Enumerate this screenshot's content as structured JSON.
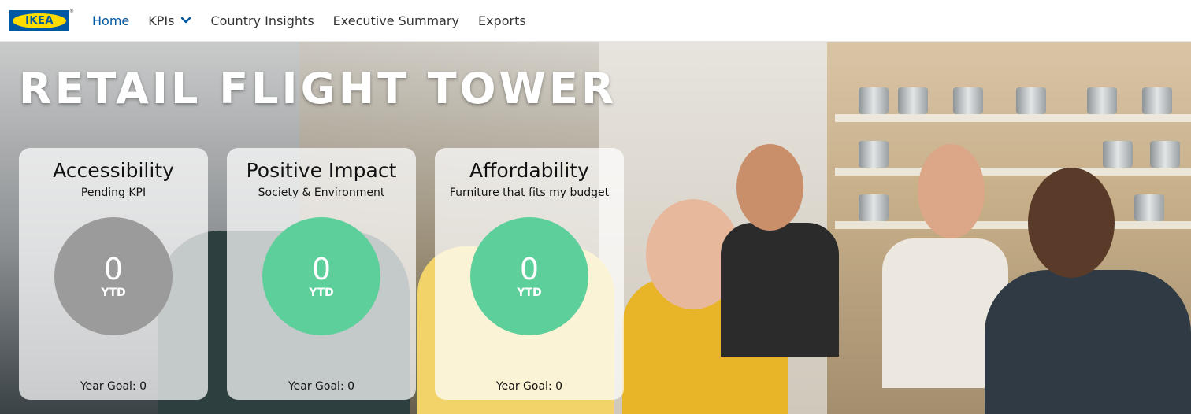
{
  "brand": {
    "logo_text": "IKEA",
    "logo_mark": "®",
    "colors": {
      "blue": "#0058a3",
      "yellow": "#ffdb00"
    }
  },
  "nav": {
    "items": [
      {
        "label": "Home",
        "active": true
      },
      {
        "label": "KPIs",
        "has_dropdown": true,
        "icon": "chevron-down-icon"
      },
      {
        "label": "Country Insights"
      },
      {
        "label": "Executive Summary"
      },
      {
        "label": "Exports"
      }
    ]
  },
  "hero": {
    "title": "RETAIL FLIGHT TOWER"
  },
  "cards": [
    {
      "title": "Accessibility",
      "subtitle": "Pending KPI",
      "value": "0",
      "unit": "YTD",
      "goal": "Year Goal: 0",
      "circle_color": "#9b9b9b"
    },
    {
      "title": "Positive Impact",
      "subtitle": "Society & Environment",
      "value": "0",
      "unit": "YTD",
      "goal": "Year Goal: 0",
      "circle_color": "#5dcf9a"
    },
    {
      "title": "Affordability",
      "subtitle": "Furniture that fits my budget",
      "value": "0",
      "unit": "YTD",
      "goal": "Year Goal: 0",
      "circle_color": "#5dcf9a"
    }
  ]
}
